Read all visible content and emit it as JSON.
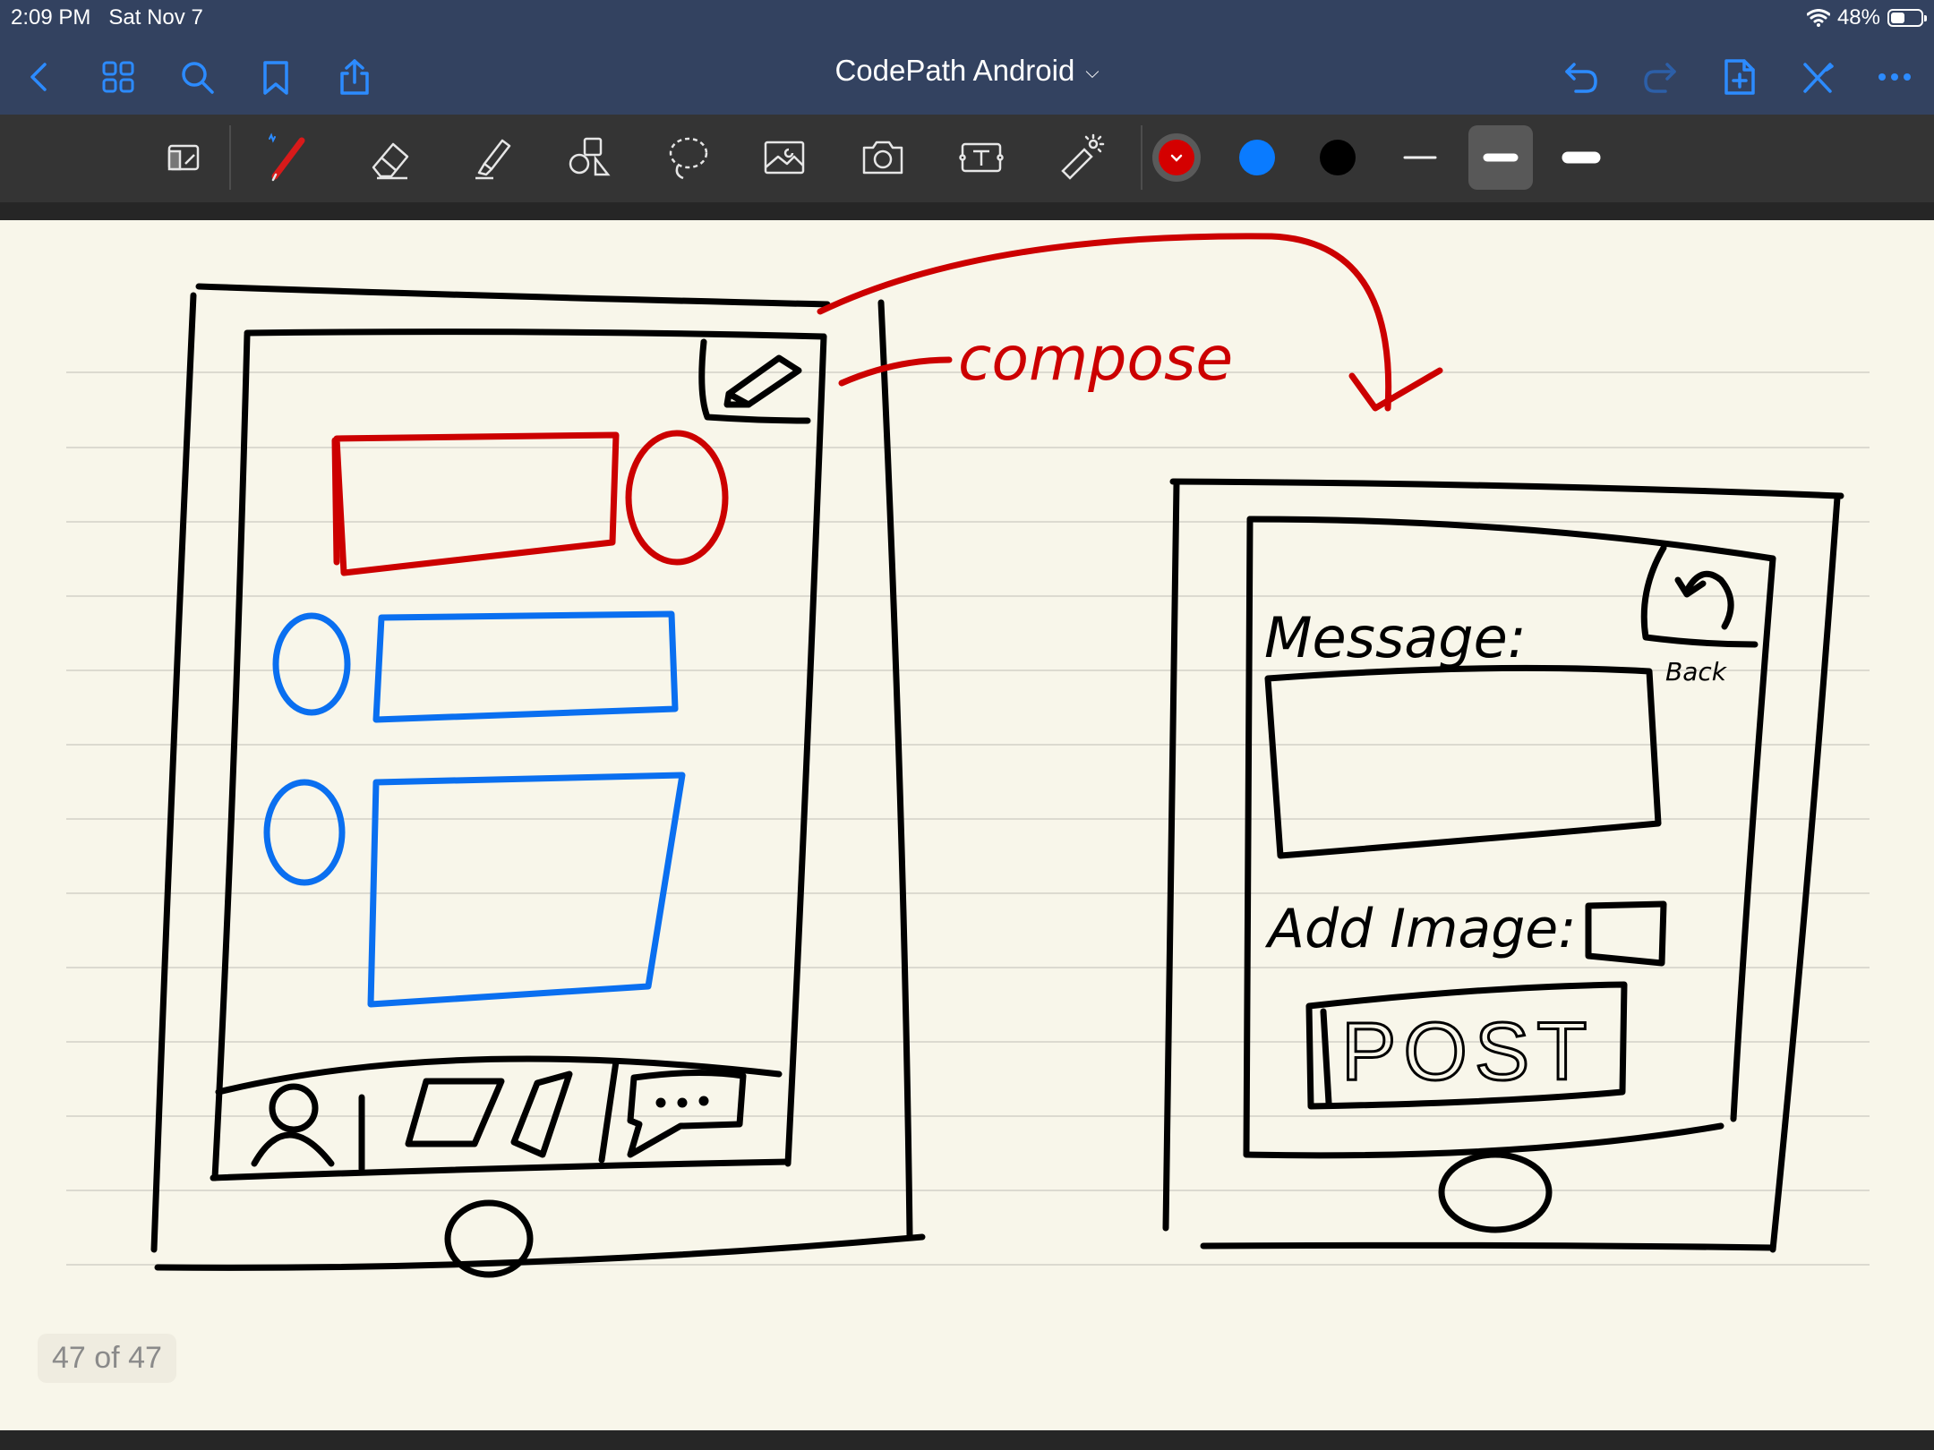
{
  "status_bar": {
    "time": "2:09 PM",
    "date": "Sat Nov 7",
    "battery": "48%",
    "battery_level": 0.48
  },
  "nav": {
    "title": "CodePath Android",
    "left_icons": [
      "back-icon",
      "grid-icon",
      "search-icon",
      "bookmark-icon",
      "share-icon"
    ],
    "right_icons": [
      "undo-icon",
      "redo-icon",
      "add-page-icon",
      "close-toolbar-icon",
      "more-icon"
    ]
  },
  "toolbar": {
    "tools": [
      "zoom-window-tool",
      "pen-tool",
      "eraser-tool",
      "highlighter-tool",
      "shapes-tool",
      "lasso-tool",
      "image-tool",
      "camera-tool",
      "text-tool",
      "laser-pointer-tool"
    ],
    "active_tool": "pen-tool",
    "colors": [
      "#d40000",
      "#0a7bff",
      "#000000"
    ],
    "active_color": "#d40000",
    "thicknesses": [
      "thin",
      "medium",
      "thick"
    ],
    "active_thickness": "medium"
  },
  "sketch": {
    "compose_label": "compose",
    "message_label": "Message:",
    "back_label": "Back",
    "add_image_label": "Add Image:",
    "post_label": "POST",
    "ink_colors": {
      "black": "#000000",
      "red": "#cc0000",
      "blue": "#0a6ff0"
    }
  },
  "page_indicator": "47 of 47"
}
